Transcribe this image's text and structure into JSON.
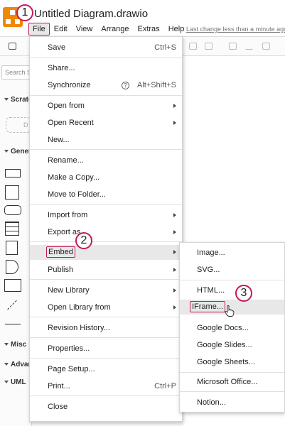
{
  "app": {
    "title": "Untitled Diagram.drawio",
    "last_change": "Last change less than a minute ago"
  },
  "menubar": [
    {
      "label": "File"
    },
    {
      "label": "Edit"
    },
    {
      "label": "View"
    },
    {
      "label": "Arrange"
    },
    {
      "label": "Extras"
    },
    {
      "label": "Help"
    }
  ],
  "sidebar": {
    "search_placeholder": "Search Shapes",
    "scratchpad": "Scratchpad",
    "draft_text": "D",
    "general": "General",
    "misc": "Misc",
    "advanced": "Advanced",
    "uml": "UML"
  },
  "file_menu": [
    {
      "label": "Save",
      "shortcut": "Ctrl+S"
    },
    {
      "label": "Share..."
    },
    {
      "label": "Synchronize",
      "help": "?",
      "shortcut": "Alt+Shift+S"
    },
    {
      "label": "Open from"
    },
    {
      "label": "Open Recent"
    },
    {
      "label": "New..."
    },
    {
      "label": "Rename..."
    },
    {
      "label": "Make a Copy..."
    },
    {
      "label": "Move to Folder..."
    },
    {
      "label": "Import from"
    },
    {
      "label": "Export as"
    },
    {
      "label": "Embed"
    },
    {
      "label": "Publish"
    },
    {
      "label": "New Library"
    },
    {
      "label": "Open Library from"
    },
    {
      "label": "Revision History..."
    },
    {
      "label": "Properties..."
    },
    {
      "label": "Page Setup..."
    },
    {
      "label": "Print...",
      "shortcut": "Ctrl+P"
    },
    {
      "label": "Close"
    }
  ],
  "embed_menu": [
    {
      "label": "Image..."
    },
    {
      "label": "SVG..."
    },
    {
      "label": "HTML..."
    },
    {
      "label": "IFrame..."
    },
    {
      "label": "Google Docs..."
    },
    {
      "label": "Google Slides..."
    },
    {
      "label": "Google Sheets..."
    },
    {
      "label": "Microsoft Office..."
    },
    {
      "label": "Notion..."
    }
  ],
  "callouts": [
    "1",
    "2",
    "3"
  ],
  "colors": {
    "accent": "#c2185b",
    "logo": "#f08705"
  }
}
